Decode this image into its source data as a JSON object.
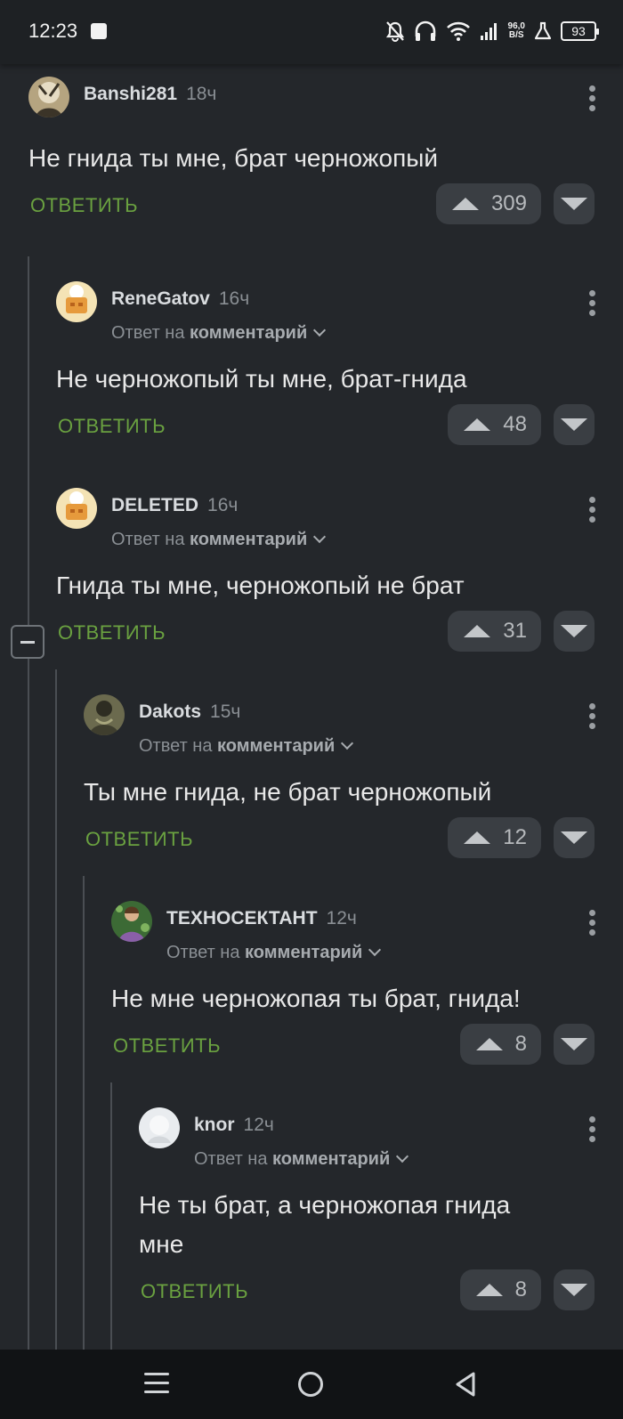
{
  "status_bar": {
    "time": "12:23",
    "net_speed_value": "96,0",
    "net_speed_unit": "B/S",
    "battery": "93",
    "icons": [
      "notifications-off-icon",
      "headphones-icon",
      "wifi-icon",
      "signal-icon",
      "lab-flask-icon",
      "battery-icon"
    ]
  },
  "comments": [
    {
      "user": "Banshi281",
      "time": "18ч",
      "reply_prefix": "",
      "reply_target": "",
      "text": "Не гнида ты мне, брат черножопый",
      "reply_label": "ОТВЕТИТЬ",
      "votes": "309"
    },
    {
      "user": "ReneGatov",
      "time": "16ч",
      "reply_prefix": "Ответ на",
      "reply_target": "комментарий",
      "text": "Не черножопый ты мне, брат-гнида",
      "reply_label": "ОТВЕТИТЬ",
      "votes": "48"
    },
    {
      "user": "DELETED",
      "time": "16ч",
      "reply_prefix": "Ответ на",
      "reply_target": "комментарий",
      "text": "Гнида ты мне, черножопый не брат",
      "reply_label": "ОТВЕТИТЬ",
      "votes": "31"
    },
    {
      "user": "Dakots",
      "time": "15ч",
      "reply_prefix": "Ответ на",
      "reply_target": "комментарий",
      "text": "Ты мне гнида, не брат черножопый",
      "reply_label": "ОТВЕТИТЬ",
      "votes": "12"
    },
    {
      "user": "ТЕХНОСЕКТАНТ",
      "time": "12ч",
      "reply_prefix": "Ответ на",
      "reply_target": "комментарий",
      "text": "Не мне черножопая ты брат, гнида!",
      "reply_label": "ОТВЕТИТЬ",
      "votes": "8"
    },
    {
      "user": "knor",
      "time": "12ч",
      "reply_prefix": "Ответ на",
      "reply_target": "комментарий",
      "text": "Не ты брат, а черножопая гнида мне",
      "reply_label": "ОТВЕТИТЬ",
      "votes": "8"
    }
  ],
  "colors": {
    "background": "#24272b",
    "reply_green": "#6aa140",
    "vote_button": "#3a3e43"
  }
}
